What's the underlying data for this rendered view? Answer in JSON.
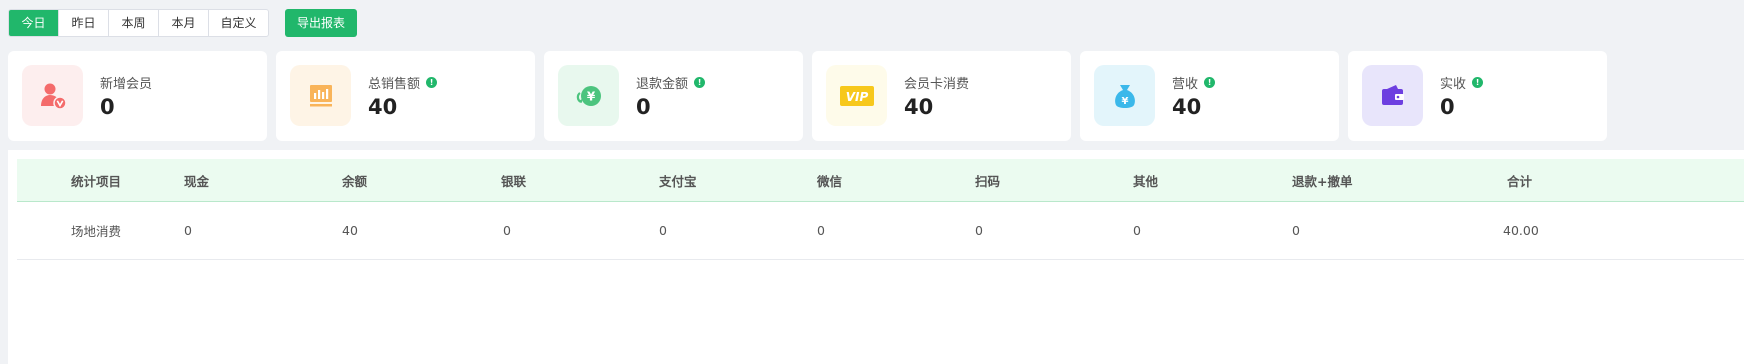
{
  "toolbar": {
    "ranges": [
      "今日",
      "昨日",
      "本周",
      "本月",
      "自定义"
    ],
    "active_range": "今日",
    "export_label": "导出报表"
  },
  "cards": [
    {
      "label": "新增会员",
      "value": "0",
      "icon": "new-member-icon",
      "has_info": false
    },
    {
      "label": "总销售额",
      "value": "40",
      "icon": "sales-chart-icon",
      "has_info": true
    },
    {
      "label": "退款金额",
      "value": "0",
      "icon": "refund-yen-icon",
      "has_info": true
    },
    {
      "label": "会员卡消费",
      "value": "40",
      "icon": "vip-card-icon",
      "has_info": false
    },
    {
      "label": "营收",
      "value": "40",
      "icon": "money-bag-icon",
      "has_info": true
    },
    {
      "label": "实收",
      "value": "0",
      "icon": "wallet-icon",
      "has_info": true
    }
  ],
  "table": {
    "headers": [
      "统计项目",
      "现金",
      "余额",
      "银联",
      "支付宝",
      "微信",
      "扫码",
      "其他",
      "退款+撤单",
      "合计"
    ],
    "rows": [
      [
        "场地消费",
        "0",
        "40",
        "0",
        "0",
        "0",
        "0",
        "0",
        "0",
        "40.00"
      ]
    ]
  },
  "colors": {
    "accent": "#21b76b",
    "link": "#2f8ef0",
    "header_bg": "#ebfbf0"
  }
}
